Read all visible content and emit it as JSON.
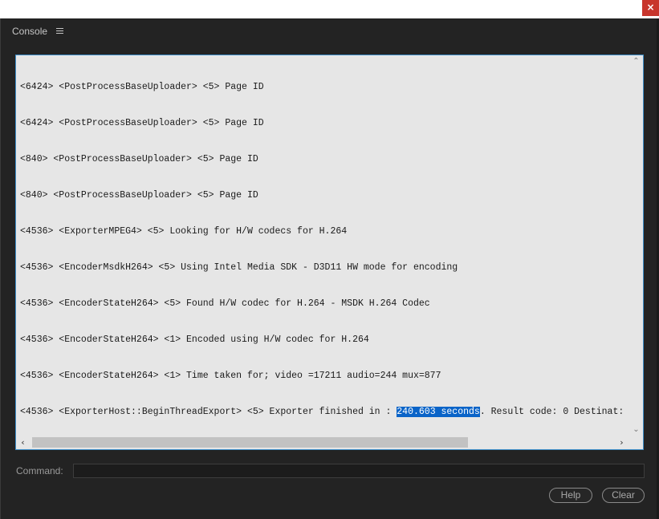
{
  "window": {
    "close_glyph": "×"
  },
  "panel": {
    "title": "Console",
    "menu_icon": "hamburger-menu-icon"
  },
  "console": {
    "lines": [
      "<6424> <PostProcessBaseUploader> <5> Page ID",
      "<6424> <PostProcessBaseUploader> <5> Page ID",
      "<840> <PostProcessBaseUploader> <5> Page ID",
      "<840> <PostProcessBaseUploader> <5> Page ID",
      "<4536> <ExporterMPEG4> <5> Looking for H/W codecs for H.264",
      "<4536> <EncoderMsdkH264> <5> Using Intel Media SDK - D3D11 HW mode for encoding",
      "<4536> <EncoderStateH264> <5> Found H/W codec for H.264 - MSDK H.264 Codec",
      "<4536> <EncoderStateH264> <1> Encoded using H/W codec for H.264",
      "<4536> <EncoderStateH264> <1> Time taken for; video =17211 audio=244 mux=877"
    ],
    "last_line": {
      "before": "<4536> <ExporterHost::BeginThreadExport> <5> Exporter finished in : ",
      "selected": "240.603 seconds",
      "after": ". Result code: 0 Destinat:"
    },
    "selection_color": "#0a64c8"
  },
  "scroll": {
    "up_glyph": "⌃",
    "down_glyph": "⌄",
    "left_glyph": "‹",
    "right_glyph": "›"
  },
  "command": {
    "label": "Command:",
    "value": "",
    "placeholder": ""
  },
  "buttons": {
    "help": "Help",
    "clear": "Clear"
  },
  "colors": {
    "background": "#232323",
    "console_bg": "#e6e6e6",
    "console_border": "#3e8fc9",
    "close_button": "#c8352c"
  }
}
